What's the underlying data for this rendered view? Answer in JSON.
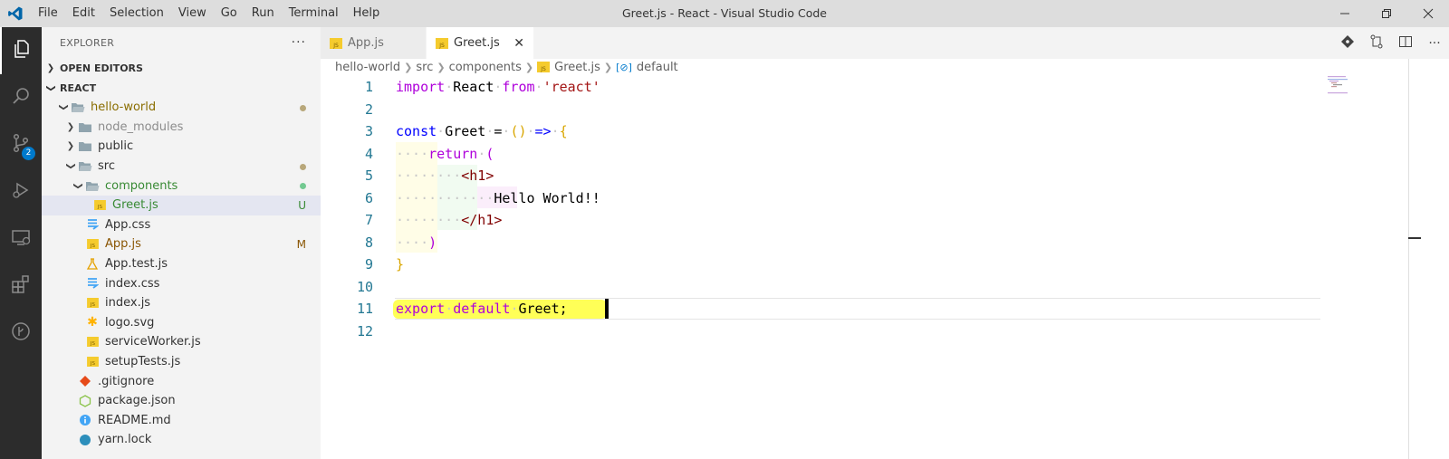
{
  "window": {
    "title": "Greet.js - React - Visual Studio Code",
    "menu": [
      "File",
      "Edit",
      "Selection",
      "View",
      "Go",
      "Run",
      "Terminal",
      "Help"
    ]
  },
  "activity": {
    "scm_badge": "2"
  },
  "sidebar": {
    "title": "EXPLORER",
    "more": "···",
    "open_editors": "OPEN EDITORS",
    "workspace": "REACT",
    "tree": [
      {
        "label": "hello-world",
        "depth": 1,
        "type": "folder-open",
        "color": "#8a6d00",
        "deco": "dot",
        "deco_color": "#b8a77a"
      },
      {
        "label": "node_modules",
        "depth": 2,
        "type": "folder",
        "color": "#8c8c8c",
        "deco": ""
      },
      {
        "label": "public",
        "depth": 2,
        "type": "folder",
        "color": "#333333",
        "deco": ""
      },
      {
        "label": "src",
        "depth": 2,
        "type": "folder-open",
        "color": "#333333",
        "deco": "dot",
        "deco_color": "#b8a77a"
      },
      {
        "label": "components",
        "depth": 3,
        "type": "folder-open",
        "color": "#388a34",
        "deco": "dot",
        "deco_color": "#73c991"
      },
      {
        "label": "Greet.js",
        "depth": 4,
        "type": "js",
        "color": "#388a34",
        "deco": "U",
        "deco_color": "#388a34",
        "selected": true
      },
      {
        "label": "App.css",
        "depth": 3,
        "type": "css",
        "color": "#333333",
        "deco": ""
      },
      {
        "label": "App.js",
        "depth": 3,
        "type": "js",
        "color": "#895503",
        "deco": "M",
        "deco_color": "#895503"
      },
      {
        "label": "App.test.js",
        "depth": 3,
        "type": "test",
        "color": "#333333",
        "deco": ""
      },
      {
        "label": "index.css",
        "depth": 3,
        "type": "css",
        "color": "#333333",
        "deco": ""
      },
      {
        "label": "index.js",
        "depth": 3,
        "type": "js",
        "color": "#333333",
        "deco": ""
      },
      {
        "label": "logo.svg",
        "depth": 3,
        "type": "svg",
        "color": "#333333",
        "deco": ""
      },
      {
        "label": "serviceWorker.js",
        "depth": 3,
        "type": "js",
        "color": "#333333",
        "deco": ""
      },
      {
        "label": "setupTests.js",
        "depth": 3,
        "type": "js",
        "color": "#333333",
        "deco": ""
      },
      {
        "label": ".gitignore",
        "depth": 2,
        "type": "git",
        "color": "#333333",
        "deco": ""
      },
      {
        "label": "package.json",
        "depth": 2,
        "type": "node",
        "color": "#333333",
        "deco": ""
      },
      {
        "label": "README.md",
        "depth": 2,
        "type": "info",
        "color": "#333333",
        "deco": ""
      },
      {
        "label": "yarn.lock",
        "depth": 2,
        "type": "yarn",
        "color": "#333333",
        "deco": ""
      }
    ]
  },
  "tabs": [
    {
      "label": "App.js",
      "active": false
    },
    {
      "label": "Greet.js",
      "active": true,
      "close": "✕"
    }
  ],
  "breadcrumb": [
    "hello-world",
    "src",
    "components",
    "Greet.js",
    "default"
  ],
  "code": {
    "line_numbers": [
      "1",
      "2",
      "3",
      "4",
      "5",
      "6",
      "7",
      "8",
      "9",
      "10",
      "11",
      "12"
    ],
    "lines": {
      "l1": {
        "kw": "import",
        "name": "React",
        "from": "from",
        "str": "'react'"
      },
      "l3": {
        "kw": "const",
        "name": "Greet",
        "eq": "=",
        "parens": "()",
        "arrow": "=>",
        "brace": "{"
      },
      "l4": {
        "kw": "return",
        "paren": "("
      },
      "l5": {
        "tag": "<h1>"
      },
      "l6": {
        "text": "Hello World!!"
      },
      "l7": {
        "tag": "</h1>"
      },
      "l8": {
        "paren": ")"
      },
      "l9": {
        "brace": "}"
      },
      "l11": {
        "export": "export",
        "default": "default",
        "name": "Greet;"
      }
    }
  },
  "colors": {
    "activity_bg": "#2c2c2c",
    "sidebar_bg": "#f3f3f3",
    "accent": "#007acc",
    "highlight": "#ffff3a"
  }
}
